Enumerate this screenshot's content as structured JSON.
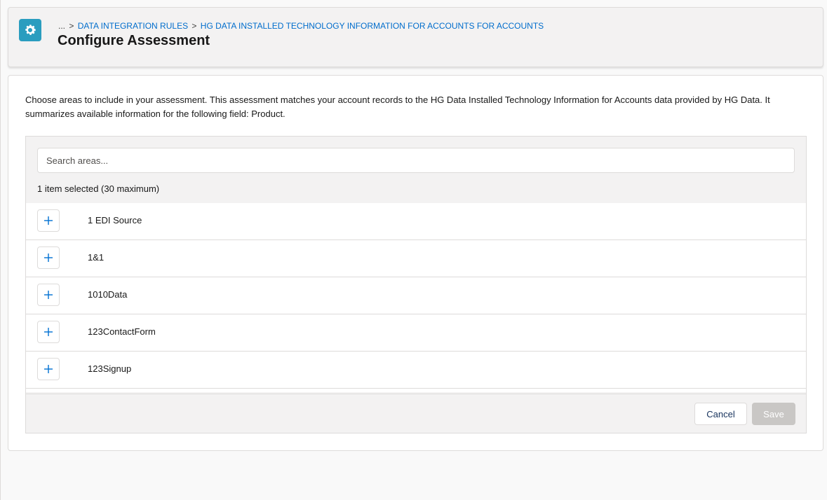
{
  "header": {
    "breadcrumb": {
      "ellipsis": "...",
      "separator": ">",
      "items": [
        "DATA INTEGRATION RULES",
        "HG DATA INSTALLED TECHNOLOGY INFORMATION FOR ACCOUNTS FOR ACCOUNTS"
      ]
    },
    "title": "Configure Assessment",
    "icon": "gear-icon"
  },
  "main": {
    "description": "Choose areas to include in your assessment. This assessment matches your account records to the HG Data Installed Technology Information for Accounts data provided by HG Data. It summarizes available information for the following field: Product.",
    "search": {
      "placeholder": "Search areas...",
      "value": ""
    },
    "selected_count": "1 item selected (30 maximum)",
    "areas": [
      {
        "label": "1 EDI Source",
        "icon": "plus-icon"
      },
      {
        "label": "1&1",
        "icon": "plus-icon"
      },
      {
        "label": "1010Data",
        "icon": "plus-icon"
      },
      {
        "label": "123ContactForm",
        "icon": "plus-icon"
      },
      {
        "label": "123Signup",
        "icon": "plus-icon"
      }
    ],
    "footer": {
      "cancel_label": "Cancel",
      "save_label": "Save"
    }
  },
  "colors": {
    "accent": "#2a9dbf",
    "link": "#006dcc",
    "add_icon": "#0070d2",
    "save_disabled": "#c9c7c5"
  }
}
